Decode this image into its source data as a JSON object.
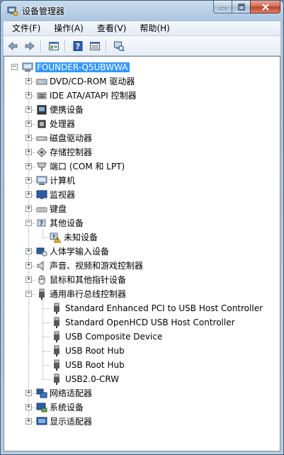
{
  "window": {
    "title": "设备管理器",
    "caption": {
      "minimize_icon": "minimize-icon",
      "maximize_icon": "maximize-icon",
      "close_icon": "close-icon"
    }
  },
  "menu": [
    "文件(F)",
    "操作(A)",
    "查看(V)",
    "帮助(H)"
  ],
  "toolbar": {
    "buttons": [
      "back-arrow-icon",
      "forward-arrow-icon",
      "properties-icon",
      "help-icon",
      "view-icon",
      "scan-hardware-icon"
    ]
  },
  "tree": {
    "root": "FOUNDER-Q5UBWWA",
    "categories": [
      "DVD/CD-ROM 驱动器",
      "IDE ATA/ATAPI 控制器",
      "便携设备",
      "处理器",
      "磁盘驱动器",
      "存储控制器",
      "端口 (COM 和 LPT)",
      "计算机",
      "监视器",
      "键盘",
      "其他设备",
      "人体学输入设备",
      "声音、视频和游戏控制器",
      "鼠标和其他指针设备",
      "通用串行总线控制器",
      "网络适配器",
      "系统设备",
      "显示适配器"
    ],
    "other_devices_children": [
      "未知设备"
    ],
    "usb_children": [
      "Standard Enhanced PCI to USB Host Controller",
      "Standard OpenHCD USB Host Controller",
      "USB Composite Device",
      "USB Root Hub",
      "USB Root Hub",
      "USB2.0-CRW"
    ]
  },
  "colors": {
    "selection": "#3399ff",
    "title_gradient_top": "#c9dcee",
    "close_button": "#cf6a51"
  }
}
